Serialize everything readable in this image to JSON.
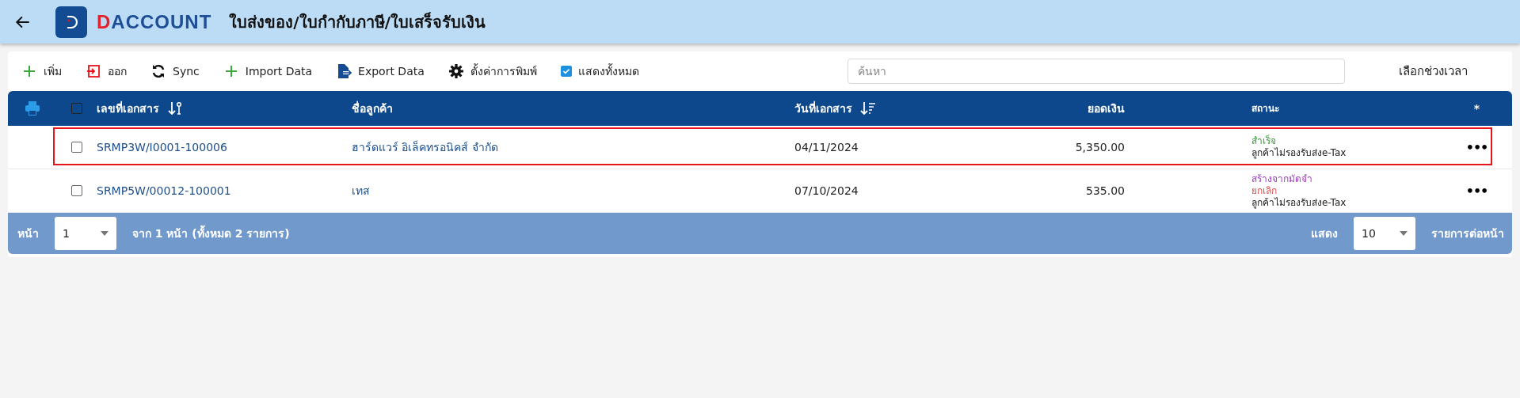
{
  "header": {
    "brand": "DACCOUNT",
    "title": "ใบส่งของ/ใบกำกับภาษี/ใบเสร็จรับเงิน"
  },
  "toolbar": [
    {
      "kind": "add",
      "label": "เพิ่ม"
    },
    {
      "kind": "exit",
      "label": "ออก"
    },
    {
      "kind": "sync",
      "label": "Sync"
    },
    {
      "kind": "add",
      "label": "Import Data"
    },
    {
      "kind": "export",
      "label": "Export Data"
    },
    {
      "kind": "settings",
      "label": "ตั้งค่าการพิมพ์"
    },
    {
      "kind": "checkbox",
      "label": "แสดงทั้งหมด",
      "checked": true
    }
  ],
  "search": {
    "placeholder": "ค้นหา"
  },
  "date_range": "เลือกช่วงเวลา",
  "table": {
    "select_all": {
      "checked": false
    },
    "columns": [
      {
        "label": "เลขที่เอกสาร",
        "kind": "alpha"
      },
      {
        "label": "ชื่อลูกค้า",
        "kind": "plain"
      },
      {
        "label": "วันที่เอกสาร",
        "kind": "desc"
      },
      {
        "label": "ยอดเงิน",
        "kind": "plain"
      },
      {
        "label": "สถานะ",
        "kind": "plain"
      },
      {
        "label": "*",
        "kind": "plain"
      }
    ],
    "rows": [
      {
        "checked": false,
        "highlighted": true,
        "doc_no": "SRMP3W/I0001-100006",
        "customer": "ฮาร์ดแวร์ อิเล็คทรอนิคส์ จำกัด",
        "date": "04/11/2024",
        "amount": "5,350.00",
        "status": [
          {
            "text": "สำเร็จ",
            "color": "#3a9c3a"
          },
          {
            "text": "ลูกค้าไม่รองรับส่งe-Tax",
            "color": "#222222"
          }
        ],
        "menu": "•••"
      },
      {
        "checked": false,
        "highlighted": false,
        "doc_no": "SRMP5W/00012-100001",
        "customer": "เทส",
        "date": "07/10/2024",
        "amount": "535.00",
        "status": [
          {
            "text": "สร้างจากมัดจำ",
            "color": "#a040c0"
          },
          {
            "text": "ยกเลิก",
            "color": "#e05050"
          },
          {
            "text": "ลูกค้าไม่รองรับส่งe-Tax",
            "color": "#222222"
          }
        ],
        "menu": "•••"
      }
    ]
  },
  "footer": {
    "page_label": "หน้า",
    "page": "1",
    "page_info": "จาก 1 หน้า (ทั้งหมด 2 รายการ)",
    "show_label": "แสดง",
    "per_page": "10",
    "per_page_label": "รายการต่อหน้า"
  }
}
